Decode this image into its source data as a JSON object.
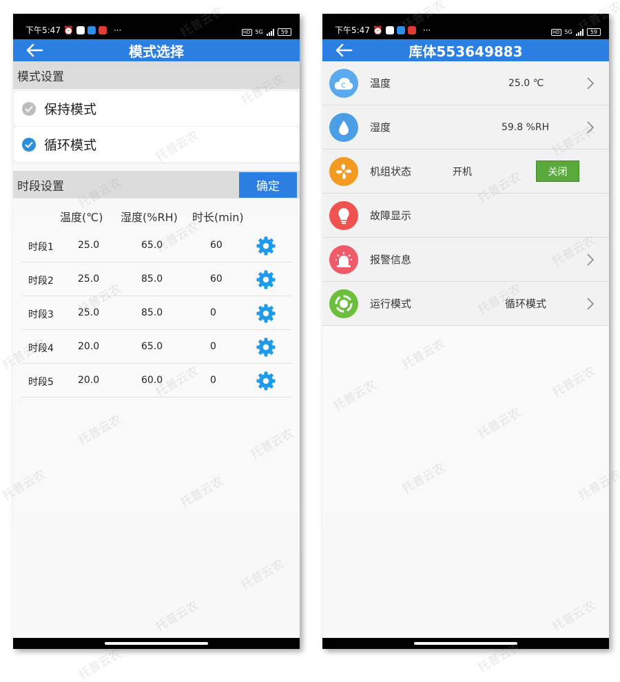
{
  "status_bar": {
    "time": "下午5:47",
    "dots": "···",
    "network": "5G",
    "battery": "59"
  },
  "left": {
    "title": "模式选择",
    "mode_section": "模式设置",
    "modes": [
      {
        "label": "保持模式",
        "checked": false
      },
      {
        "label": "循环模式",
        "checked": true
      }
    ],
    "period_section": "时段设置",
    "confirm_label": "确定",
    "columns": {
      "temp": "温度(℃)",
      "humidity": "湿度(%RH)",
      "duration": "时长(min)"
    },
    "periods": [
      {
        "name": "时段1",
        "temp": "25.0",
        "humidity": "65.0",
        "duration": "60"
      },
      {
        "name": "时段2",
        "temp": "25.0",
        "humidity": "85.0",
        "duration": "60"
      },
      {
        "name": "时段3",
        "temp": "25.0",
        "humidity": "85.0",
        "duration": "0"
      },
      {
        "name": "时段4",
        "temp": "20.0",
        "humidity": "65.0",
        "duration": "0"
      },
      {
        "name": "时段5",
        "temp": "20.0",
        "humidity": "60.0",
        "duration": "0"
      }
    ]
  },
  "right": {
    "title": "库体553649883",
    "temperature": {
      "label": "温度",
      "value": "25.0 ℃"
    },
    "humidity": {
      "label": "湿度",
      "value": "59.8 %RH"
    },
    "unit_status": {
      "label": "机组状态",
      "value": "开机",
      "button": "关闭"
    },
    "fault": {
      "label": "故障显示"
    },
    "alarm": {
      "label": "报警信息"
    },
    "run_mode": {
      "label": "运行模式",
      "value": "循环模式"
    }
  },
  "watermark": "托普云农",
  "colors": {
    "primary": "#2b7ee2",
    "checked": "#2b8fe0",
    "gear": "#1e9be8",
    "close_btn": "#5ba83c"
  }
}
